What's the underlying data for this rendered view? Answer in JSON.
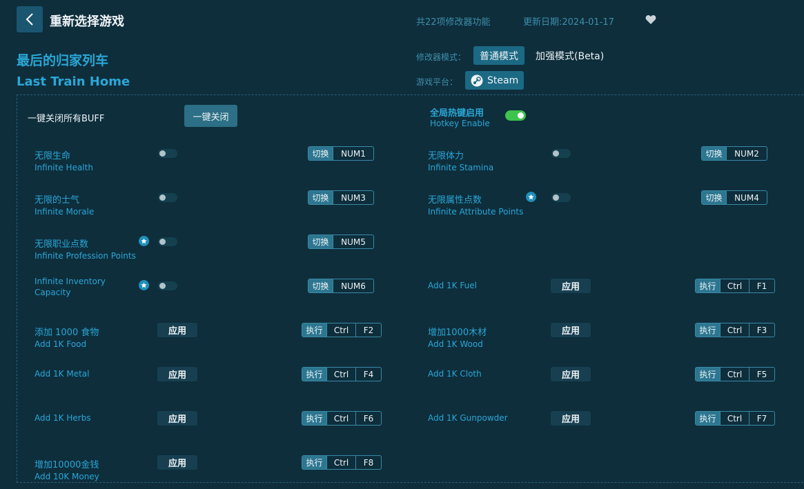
{
  "header": {
    "title": "重新选择游戏",
    "feature_count": "共22项修改器功能",
    "update_date": "更新日期:2024-01-17"
  },
  "game": {
    "name_cn": "最后的归家列车",
    "name_en": "Last Train Home"
  },
  "mode": {
    "label": "修改器模式：",
    "normal": "普通模式",
    "enhanced": "加强模式(Beta)",
    "platform_label": "游戏平台：",
    "platform": "Steam"
  },
  "controls": {
    "all_off_label": "一键关闭所有BUFF",
    "all_off_button": "一键关闭",
    "hotkey_cn": "全局热键启用",
    "hotkey_en": "Hotkey Enable",
    "hotkey_enabled": true
  },
  "labels": {
    "toggle_tag": "切换",
    "exec_tag": "执行",
    "apply": "应用"
  },
  "features": [
    {
      "cn": "无限生命",
      "en": "Infinite Health",
      "type": "toggle",
      "keys": [
        "NUM1"
      ],
      "star": false
    },
    {
      "cn": "无限体力",
      "en": "Infinite Stamina",
      "type": "toggle",
      "keys": [
        "NUM2"
      ],
      "star": false
    },
    {
      "cn": "无限的士气",
      "en": "Infinite Morale",
      "type": "toggle",
      "keys": [
        "NUM3"
      ],
      "star": false
    },
    {
      "cn": "无限属性点数",
      "en": "Infinite Attribute Points",
      "type": "toggle",
      "keys": [
        "NUM4"
      ],
      "star": true
    },
    {
      "cn": "无限职业点数",
      "en": "Infinite Profession Points",
      "type": "toggle",
      "keys": [
        "NUM5"
      ],
      "star": true
    },
    {
      "cn": "",
      "en": "Infinite Inventory Capacity",
      "type": "toggle",
      "keys": [
        "NUM6"
      ],
      "star": true
    },
    {
      "cn": "",
      "en": "Add 1K Fuel",
      "type": "apply",
      "keys": [
        "Ctrl",
        "F1"
      ],
      "star": false
    },
    {
      "cn": "添加 1000 食物",
      "en": "Add 1K Food",
      "type": "apply",
      "keys": [
        "Ctrl",
        "F2"
      ],
      "star": false
    },
    {
      "cn": "增加1000木材",
      "en": "Add 1K Wood",
      "type": "apply",
      "keys": [
        "Ctrl",
        "F3"
      ],
      "star": false
    },
    {
      "cn": "",
      "en": "Add 1K Metal",
      "type": "apply",
      "keys": [
        "Ctrl",
        "F4"
      ],
      "star": false
    },
    {
      "cn": "",
      "en": "Add 1K Cloth",
      "type": "apply",
      "keys": [
        "Ctrl",
        "F5"
      ],
      "star": false
    },
    {
      "cn": "",
      "en": "Add 1K Herbs",
      "type": "apply",
      "keys": [
        "Ctrl",
        "F6"
      ],
      "star": false
    },
    {
      "cn": "",
      "en": "Add 1K Gunpowder",
      "type": "apply",
      "keys": [
        "Ctrl",
        "F7"
      ],
      "star": false
    },
    {
      "cn": "增加10000金钱",
      "en": "Add 10K Money",
      "type": "apply",
      "keys": [
        "Ctrl",
        "F8"
      ],
      "star": false
    }
  ],
  "colors": {
    "background": "#0e2e3c",
    "accent": "#2aa7d6",
    "toggle_on": "#3ec34e"
  }
}
